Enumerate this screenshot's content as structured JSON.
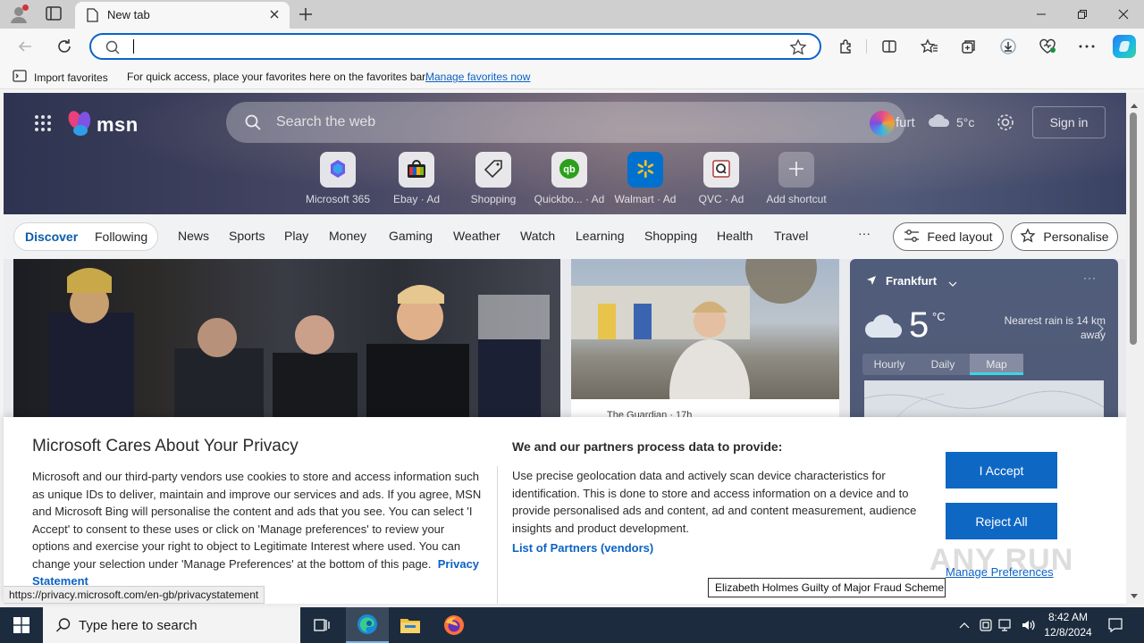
{
  "browser": {
    "tab": {
      "title": "New tab"
    },
    "address_bar": {
      "value": ""
    },
    "favorites_bar": {
      "import_label": "Import favorites",
      "hint": "For quick access, place your favorites here on the favorites bar.",
      "manage_link": "Manage favorites now"
    }
  },
  "msn": {
    "logo_text": "msn",
    "search_placeholder": "Search the web",
    "location": "Frankfurt",
    "location_visible": "furt",
    "temperature": "5°c",
    "sign_in": "Sign in",
    "shortcuts": [
      {
        "label": "Microsoft 365",
        "icon": "m365-icon"
      },
      {
        "label": "Ebay · Ad",
        "icon": "ebay-icon"
      },
      {
        "label": "Shopping",
        "icon": "shopping-tag-icon"
      },
      {
        "label": "Quickbo... · Ad",
        "icon": "quickbooks-icon"
      },
      {
        "label": "Walmart · Ad",
        "icon": "walmart-icon"
      },
      {
        "label": "QVC · Ad",
        "icon": "qvc-icon"
      },
      {
        "label": "Add shortcut",
        "icon": "plus-icon"
      }
    ],
    "feed_nav": {
      "discover": "Discover",
      "following": "Following",
      "tabs": [
        "News",
        "Sports",
        "Play",
        "Money",
        "Gaming",
        "Weather",
        "Watch",
        "Learning",
        "Shopping",
        "Health",
        "Travel"
      ],
      "more": "···",
      "feed_layout": "Feed layout",
      "personalise": "Personalise"
    },
    "news_card_source": "The Guardian · 17h",
    "weather_card": {
      "city": "Frankfurt",
      "temp": "5",
      "unit": "°C",
      "rain": "Nearest rain is 14 km away",
      "tabs": [
        "Hourly",
        "Daily",
        "Map"
      ],
      "active_tab": "Map"
    }
  },
  "privacy": {
    "title": "Microsoft Cares About Your Privacy",
    "body": "Microsoft and our third-party vendors use cookies to store and access information such as unique IDs to deliver, maintain and improve our services and ads. If you agree, MSN and Microsoft Bing will personalise the content and ads that you see. You can select 'I Accept' to consent to these uses or click on 'Manage preferences' to review your options and exercise your right to object to Legitimate Interest where used.  You can change your selection under 'Manage Preferences' at the bottom of this page.",
    "privacy_link": "Privacy Statement",
    "right_title": "We and our partners process data to provide:",
    "right_body": "Use precise geolocation data and actively scan device characteristics for identification. This is done to store and access information on a device and to provide personalised ads and content, ad and content measurement, audience insights and product development.",
    "partners_link": "List of Partners (vendors)",
    "accept": "I Accept",
    "reject": "Reject All",
    "manage": "Manage Preferences"
  },
  "tooltip": "Elizabeth Holmes Guilty of Major Fraud Scheme",
  "status_url": "https://privacy.microsoft.com/en-gb/privacystatement",
  "watermark": "ANY RUN",
  "taskbar": {
    "search_placeholder": "Type here to search",
    "time": "8:42 AM",
    "date": "12/8/2024"
  }
}
